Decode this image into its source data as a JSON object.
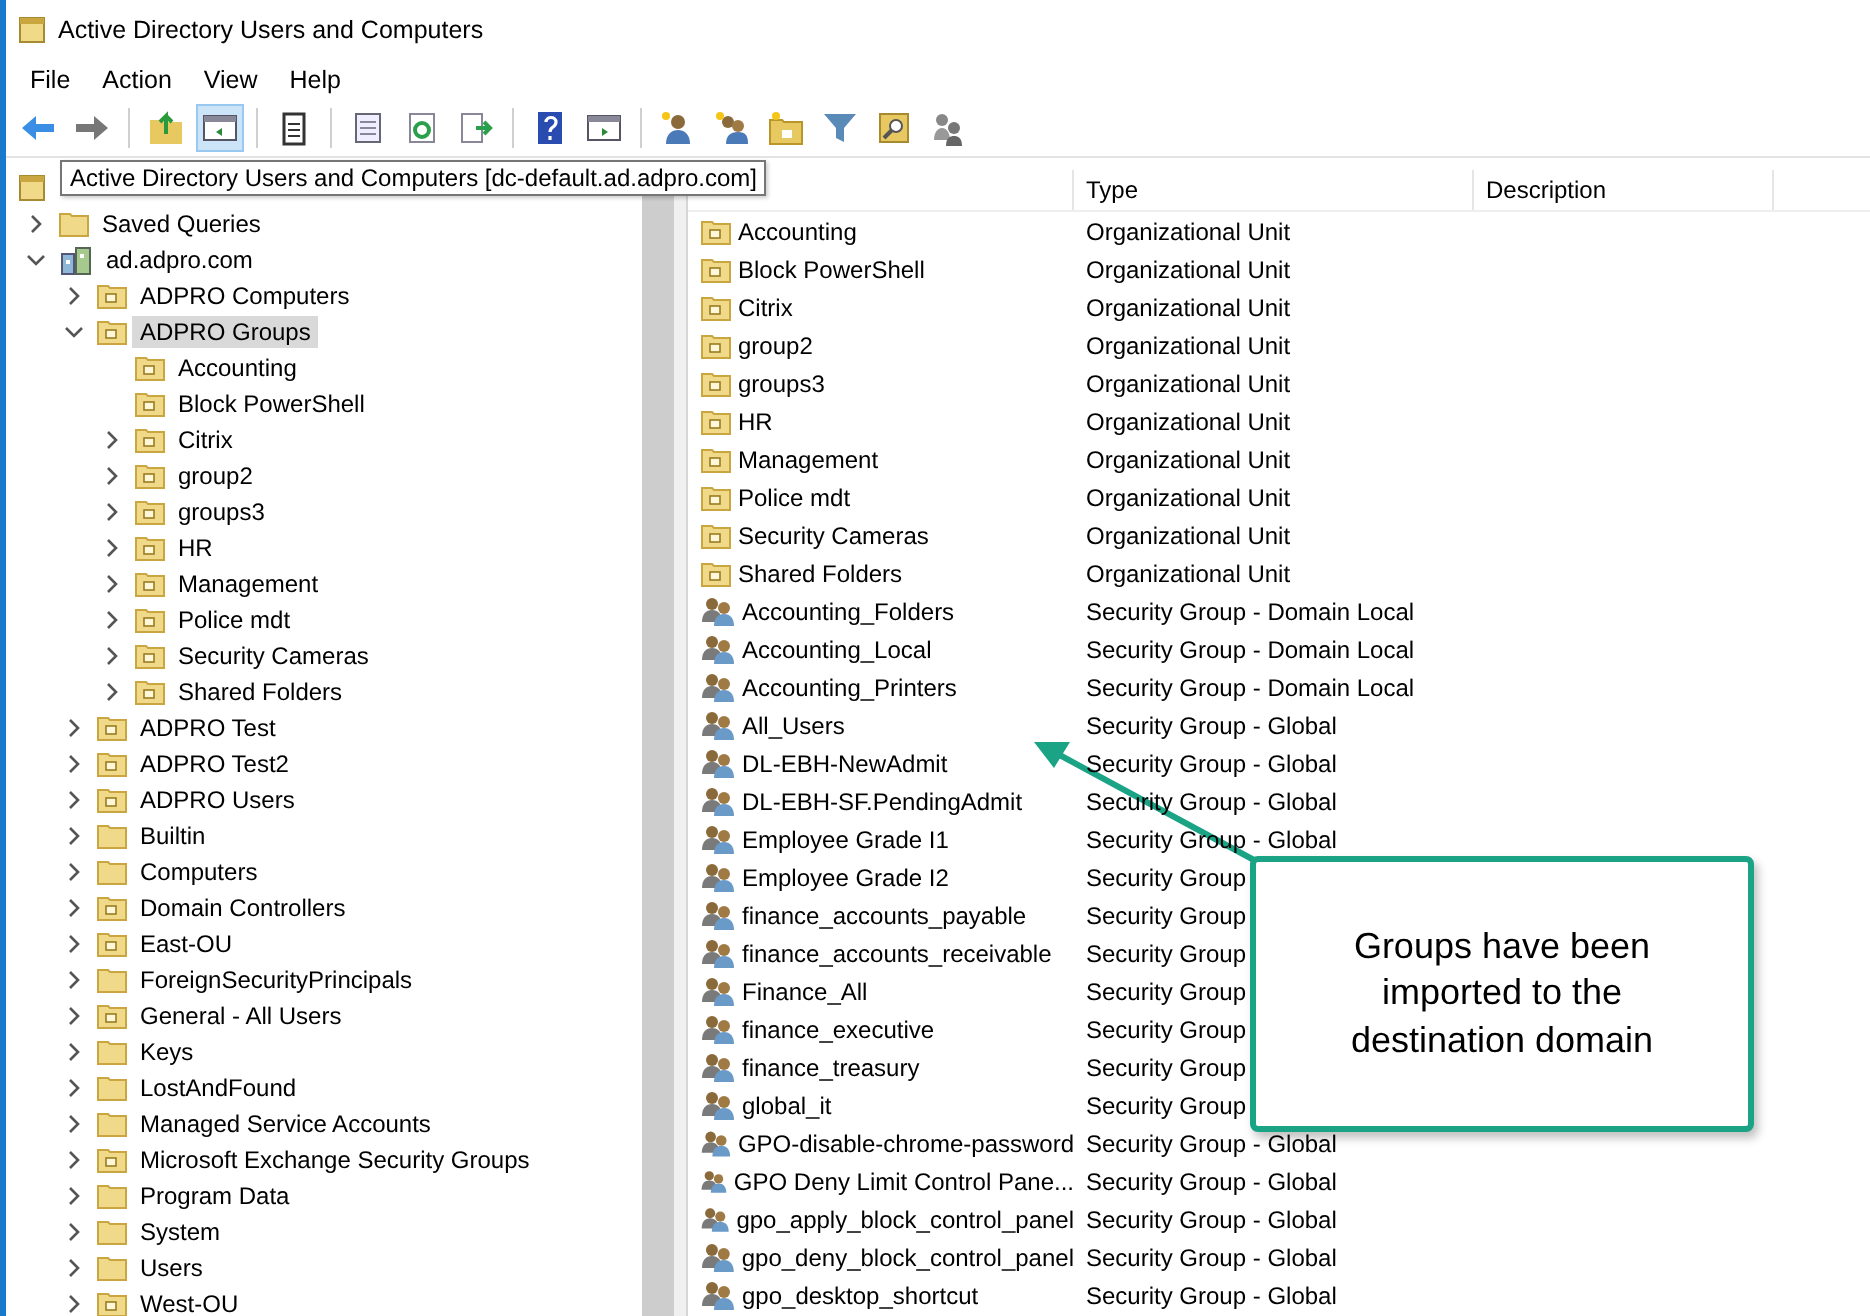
{
  "window": {
    "title": "Active Directory Users and Computers"
  },
  "menu": [
    "File",
    "Action",
    "View",
    "Help"
  ],
  "toolbar": [
    {
      "kind": "back",
      "pressed": false
    },
    {
      "kind": "forward",
      "pressed": false
    },
    {
      "kind": "sep"
    },
    {
      "kind": "up",
      "pressed": false
    },
    {
      "kind": "tree",
      "pressed": true
    },
    {
      "kind": "sep"
    },
    {
      "kind": "clipboard",
      "pressed": false
    },
    {
      "kind": "sep"
    },
    {
      "kind": "properties",
      "pressed": false
    },
    {
      "kind": "refresh",
      "pressed": false
    },
    {
      "kind": "export",
      "pressed": false
    },
    {
      "kind": "sep"
    },
    {
      "kind": "help",
      "pressed": false
    },
    {
      "kind": "panel",
      "pressed": false
    },
    {
      "kind": "sep"
    },
    {
      "kind": "newuser",
      "pressed": false
    },
    {
      "kind": "newgroup",
      "pressed": false
    },
    {
      "kind": "newou",
      "pressed": false
    },
    {
      "kind": "filter",
      "pressed": false
    },
    {
      "kind": "find",
      "pressed": false
    },
    {
      "kind": "users",
      "pressed": false
    }
  ],
  "tooltip": "Active Directory Users and Computers [dc-default.ad.adpro.com]",
  "tree": [
    {
      "label": "Saved Queries",
      "kind": "folder",
      "expandable": true,
      "expanded": false,
      "selected": false
    },
    {
      "label": "ad.adpro.com",
      "kind": "domain",
      "expandable": true,
      "expanded": true,
      "selected": false,
      "children": [
        {
          "label": "ADPRO Computers",
          "kind": "ou",
          "expandable": true,
          "expanded": false,
          "selected": false
        },
        {
          "label": "ADPRO Groups",
          "kind": "ou",
          "expandable": true,
          "expanded": true,
          "selected": true,
          "children": [
            {
              "label": "Accounting",
              "kind": "ou",
              "expandable": false,
              "expanded": false,
              "selected": false
            },
            {
              "label": "Block PowerShell",
              "kind": "ou",
              "expandable": false,
              "expanded": false,
              "selected": false
            },
            {
              "label": "Citrix",
              "kind": "ou",
              "expandable": true,
              "expanded": false,
              "selected": false
            },
            {
              "label": "group2",
              "kind": "ou",
              "expandable": true,
              "expanded": false,
              "selected": false
            },
            {
              "label": "groups3",
              "kind": "ou",
              "expandable": true,
              "expanded": false,
              "selected": false
            },
            {
              "label": "HR",
              "kind": "ou",
              "expandable": true,
              "expanded": false,
              "selected": false
            },
            {
              "label": "Management",
              "kind": "ou",
              "expandable": true,
              "expanded": false,
              "selected": false
            },
            {
              "label": "Police mdt",
              "kind": "ou",
              "expandable": true,
              "expanded": false,
              "selected": false
            },
            {
              "label": "Security Cameras",
              "kind": "ou",
              "expandable": true,
              "expanded": false,
              "selected": false
            },
            {
              "label": "Shared Folders",
              "kind": "ou",
              "expandable": true,
              "expanded": false,
              "selected": false
            }
          ]
        },
        {
          "label": "ADPRO Test",
          "kind": "ou",
          "expandable": true,
          "expanded": false,
          "selected": false
        },
        {
          "label": "ADPRO Test2",
          "kind": "ou",
          "expandable": true,
          "expanded": false,
          "selected": false
        },
        {
          "label": "ADPRO Users",
          "kind": "ou",
          "expandable": true,
          "expanded": false,
          "selected": false
        },
        {
          "label": "Builtin",
          "kind": "folder",
          "expandable": true,
          "expanded": false,
          "selected": false
        },
        {
          "label": "Computers",
          "kind": "folder",
          "expandable": true,
          "expanded": false,
          "selected": false
        },
        {
          "label": "Domain Controllers",
          "kind": "ou",
          "expandable": true,
          "expanded": false,
          "selected": false
        },
        {
          "label": "East-OU",
          "kind": "ou",
          "expandable": true,
          "expanded": false,
          "selected": false
        },
        {
          "label": "ForeignSecurityPrincipals",
          "kind": "folder",
          "expandable": true,
          "expanded": false,
          "selected": false
        },
        {
          "label": "General - All Users",
          "kind": "ou",
          "expandable": true,
          "expanded": false,
          "selected": false
        },
        {
          "label": "Keys",
          "kind": "folder",
          "expandable": true,
          "expanded": false,
          "selected": false
        },
        {
          "label": "LostAndFound",
          "kind": "folder",
          "expandable": true,
          "expanded": false,
          "selected": false
        },
        {
          "label": "Managed Service Accounts",
          "kind": "folder",
          "expandable": true,
          "expanded": false,
          "selected": false
        },
        {
          "label": "Microsoft Exchange Security Groups",
          "kind": "ou",
          "expandable": true,
          "expanded": false,
          "selected": false
        },
        {
          "label": "Program Data",
          "kind": "folder",
          "expandable": true,
          "expanded": false,
          "selected": false
        },
        {
          "label": "System",
          "kind": "folder",
          "expandable": true,
          "expanded": false,
          "selected": false
        },
        {
          "label": "Users",
          "kind": "folder",
          "expandable": true,
          "expanded": false,
          "selected": false
        },
        {
          "label": "West-OU",
          "kind": "ou",
          "expandable": true,
          "expanded": false,
          "selected": false
        }
      ]
    }
  ],
  "list": {
    "columns": [
      "Type",
      "Description"
    ],
    "rows": [
      {
        "name": "Accounting",
        "kind": "ou",
        "type": "Organizational Unit"
      },
      {
        "name": "Block PowerShell",
        "kind": "ou",
        "type": "Organizational Unit"
      },
      {
        "name": "Citrix",
        "kind": "ou",
        "type": "Organizational Unit"
      },
      {
        "name": "group2",
        "kind": "ou",
        "type": "Organizational Unit"
      },
      {
        "name": "groups3",
        "kind": "ou",
        "type": "Organizational Unit"
      },
      {
        "name": "HR",
        "kind": "ou",
        "type": "Organizational Unit"
      },
      {
        "name": "Management",
        "kind": "ou",
        "type": "Organizational Unit"
      },
      {
        "name": "Police mdt",
        "kind": "ou",
        "type": "Organizational Unit"
      },
      {
        "name": "Security Cameras",
        "kind": "ou",
        "type": "Organizational Unit"
      },
      {
        "name": "Shared Folders",
        "kind": "ou",
        "type": "Organizational Unit"
      },
      {
        "name": "Accounting_Folders",
        "kind": "group",
        "type": "Security Group - Domain Local"
      },
      {
        "name": "Accounting_Local",
        "kind": "group",
        "type": "Security Group - Domain Local"
      },
      {
        "name": "Accounting_Printers",
        "kind": "group",
        "type": "Security Group - Domain Local"
      },
      {
        "name": "All_Users",
        "kind": "group",
        "type": "Security Group - Global"
      },
      {
        "name": "DL-EBH-NewAdmit",
        "kind": "group",
        "type": "Security Group - Global"
      },
      {
        "name": "DL-EBH-SF.PendingAdmit",
        "kind": "group",
        "type": "Security Group - Global"
      },
      {
        "name": "Employee Grade I1",
        "kind": "group",
        "type": "Security Group - Global"
      },
      {
        "name": "Employee Grade I2",
        "kind": "group",
        "type": "Security Group"
      },
      {
        "name": "finance_accounts_payable",
        "kind": "group",
        "type": "Security Group"
      },
      {
        "name": "finance_accounts_receivable",
        "kind": "group",
        "type": "Security Group"
      },
      {
        "name": "Finance_All",
        "kind": "group",
        "type": "Security Group"
      },
      {
        "name": "finance_executive",
        "kind": "group",
        "type": "Security Group"
      },
      {
        "name": "finance_treasury",
        "kind": "group",
        "type": "Security Group"
      },
      {
        "name": "global_it",
        "kind": "group",
        "type": "Security Group"
      },
      {
        "name": "GPO-disable-chrome-password",
        "kind": "group",
        "type": "Security Group - Global"
      },
      {
        "name": "GPO Deny Limit Control Pane...",
        "kind": "group",
        "type": "Security Group - Global"
      },
      {
        "name": "gpo_apply_block_control_panel",
        "kind": "group",
        "type": "Security Group - Global"
      },
      {
        "name": "gpo_deny_block_control_panel",
        "kind": "group",
        "type": "Security Group - Global"
      },
      {
        "name": "gpo_desktop_shortcut",
        "kind": "group",
        "type": "Security Group - Global"
      }
    ]
  },
  "annotation": {
    "text": "Groups have been imported to the destination domain"
  }
}
